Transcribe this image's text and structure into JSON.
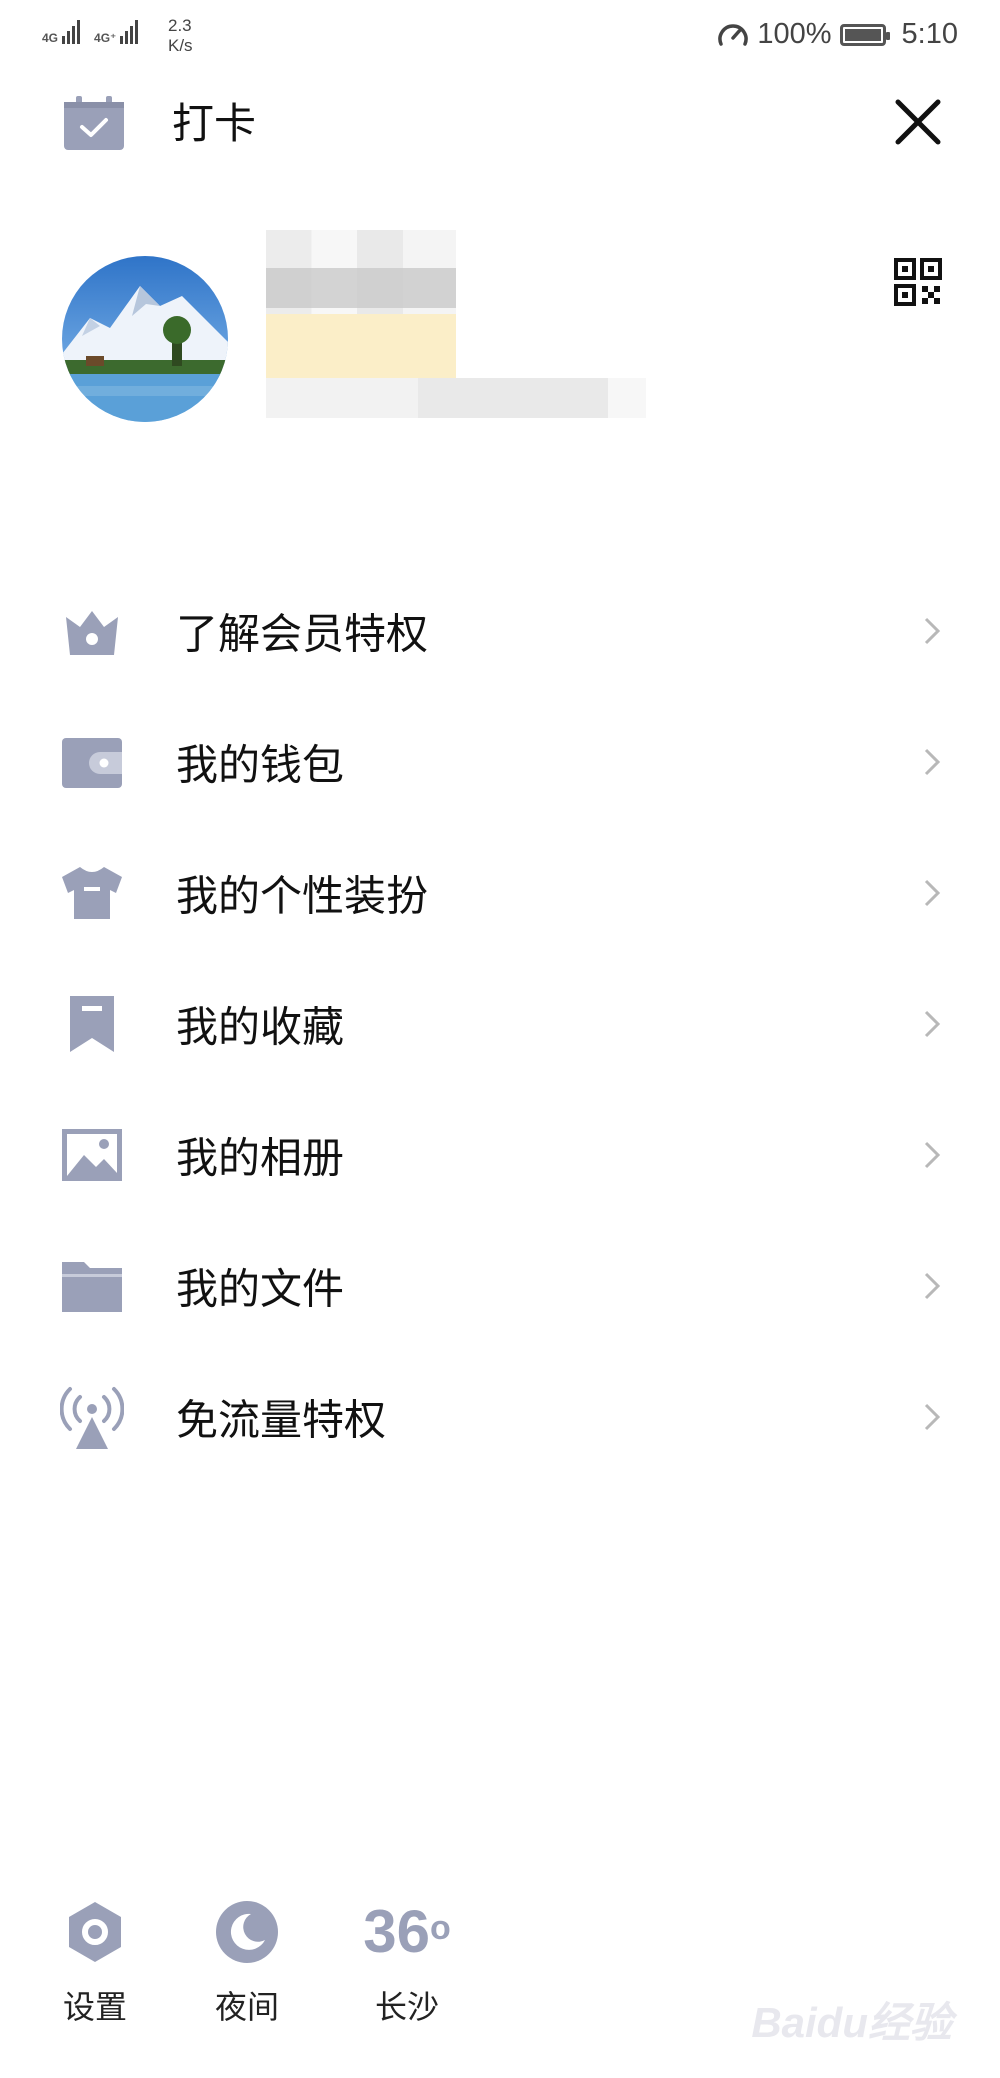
{
  "status_bar": {
    "network_1": "4G",
    "network_2": "4G⁺",
    "speed_value": "2.3",
    "speed_unit": "K/s",
    "battery": "100%",
    "time": "5:10"
  },
  "header": {
    "checkin_label": "打卡",
    "icon_color": "#9aa0b8"
  },
  "menu": {
    "items": [
      {
        "label": "了解会员特权",
        "icon": "vip-crown-icon"
      },
      {
        "label": "我的钱包",
        "icon": "wallet-icon"
      },
      {
        "label": "我的个性装扮",
        "icon": "tshirt-icon"
      },
      {
        "label": "我的收藏",
        "icon": "bookmark-icon"
      },
      {
        "label": "我的相册",
        "icon": "photo-icon"
      },
      {
        "label": "我的文件",
        "icon": "folder-icon"
      },
      {
        "label": "免流量特权",
        "icon": "signal-tower-icon"
      }
    ]
  },
  "bottom_bar": {
    "settings_label": "设置",
    "night_label": "夜间",
    "weather_temp": "36",
    "weather_city": "长沙"
  },
  "watermark": "Baidu经验"
}
